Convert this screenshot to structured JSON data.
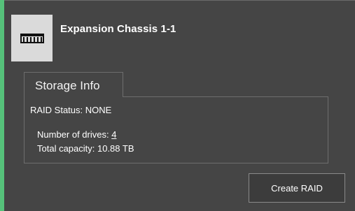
{
  "chassis": {
    "title": "Expansion Chassis 1-1",
    "icon": "drive-enclosure-icon"
  },
  "storage_info": {
    "tab_label": "Storage Info",
    "raid_status": "RAID Status: NONE",
    "drives_label": "Number of drives: ",
    "drives_value": "4",
    "capacity": "Total capacity: 10.88 TB"
  },
  "actions": {
    "create_raid_label": "Create RAID"
  },
  "colors": {
    "accent_green": "#56c17a",
    "panel_bg": "#454545",
    "icon_bg": "#dadada"
  }
}
